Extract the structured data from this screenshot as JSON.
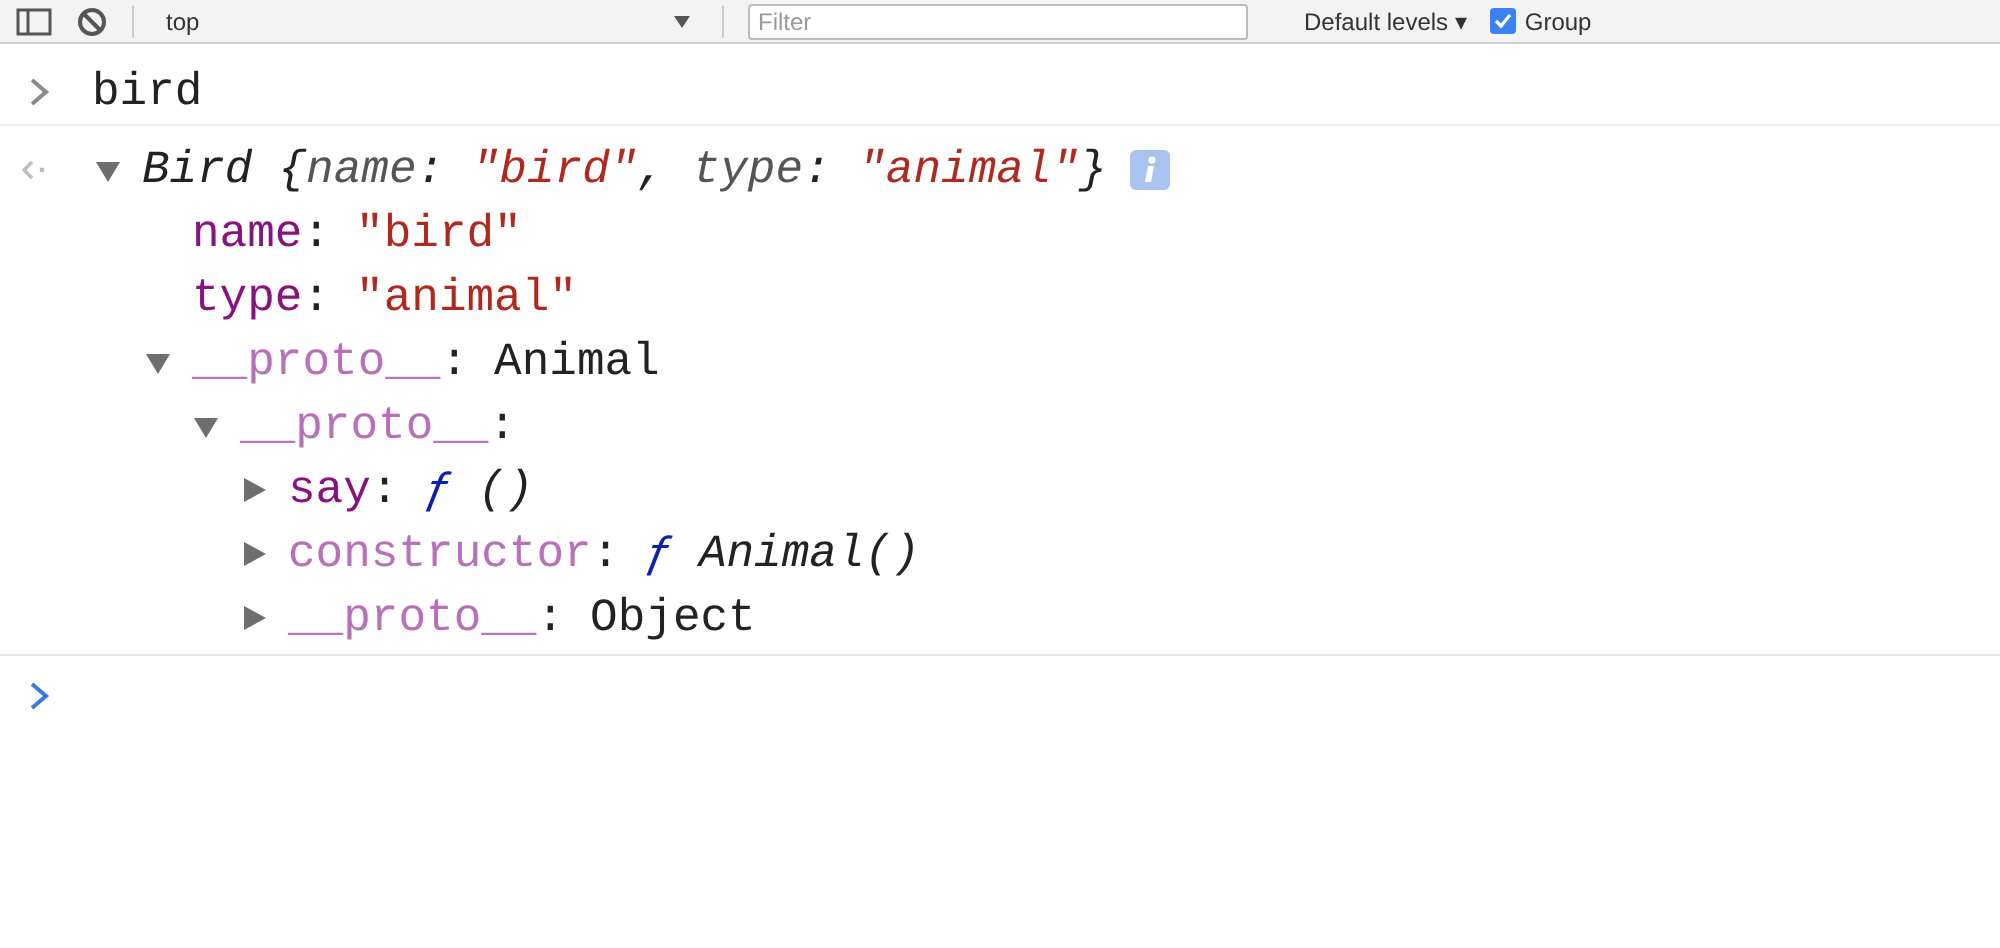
{
  "toolbar": {
    "context": "top",
    "filter": {
      "placeholder": "Filter"
    },
    "levels": "Default levels ▾",
    "group": {
      "label": "Group",
      "checked": true
    }
  },
  "input": {
    "text": "bird"
  },
  "result": {
    "class": "Bird",
    "expanded": true,
    "preview": [
      {
        "kind": "punct",
        "text": "{"
      },
      {
        "kind": "key",
        "text": "name"
      },
      {
        "kind": "punct",
        "text": ": "
      },
      {
        "kind": "string",
        "text": "\"bird\""
      },
      {
        "kind": "punct",
        "text": ", "
      },
      {
        "kind": "key",
        "text": "type"
      },
      {
        "kind": "punct",
        "text": ": "
      },
      {
        "kind": "string",
        "text": "\"animal\""
      },
      {
        "kind": "punct",
        "text": "}"
      }
    ],
    "children": [
      {
        "key": "name",
        "inherited": false,
        "colon": ":",
        "kind": "string",
        "value": "\"bird\""
      },
      {
        "key": "type",
        "inherited": false,
        "colon": ":",
        "kind": "string",
        "value": "\"animal\""
      },
      {
        "key": "__proto__",
        "inherited": true,
        "colon": ":",
        "kind": "object",
        "value": "Animal",
        "expanded": true,
        "children": [
          {
            "key": "__proto__",
            "inherited": true,
            "colon": ":",
            "expanded": true,
            "children": [
              {
                "key": "say",
                "inherited": false,
                "colon": ":",
                "kind": "function",
                "sign": "ƒ",
                "value": "()",
                "expanded": false
              },
              {
                "key": "constructor",
                "inherited": true,
                "colon": ":",
                "kind": "function",
                "sign": "ƒ",
                "value": "Animal()",
                "expanded": false
              },
              {
                "key": "__proto__",
                "inherited": true,
                "colon": ":",
                "kind": "object",
                "value": "Object",
                "expanded": false
              }
            ]
          }
        ]
      }
    ]
  }
}
